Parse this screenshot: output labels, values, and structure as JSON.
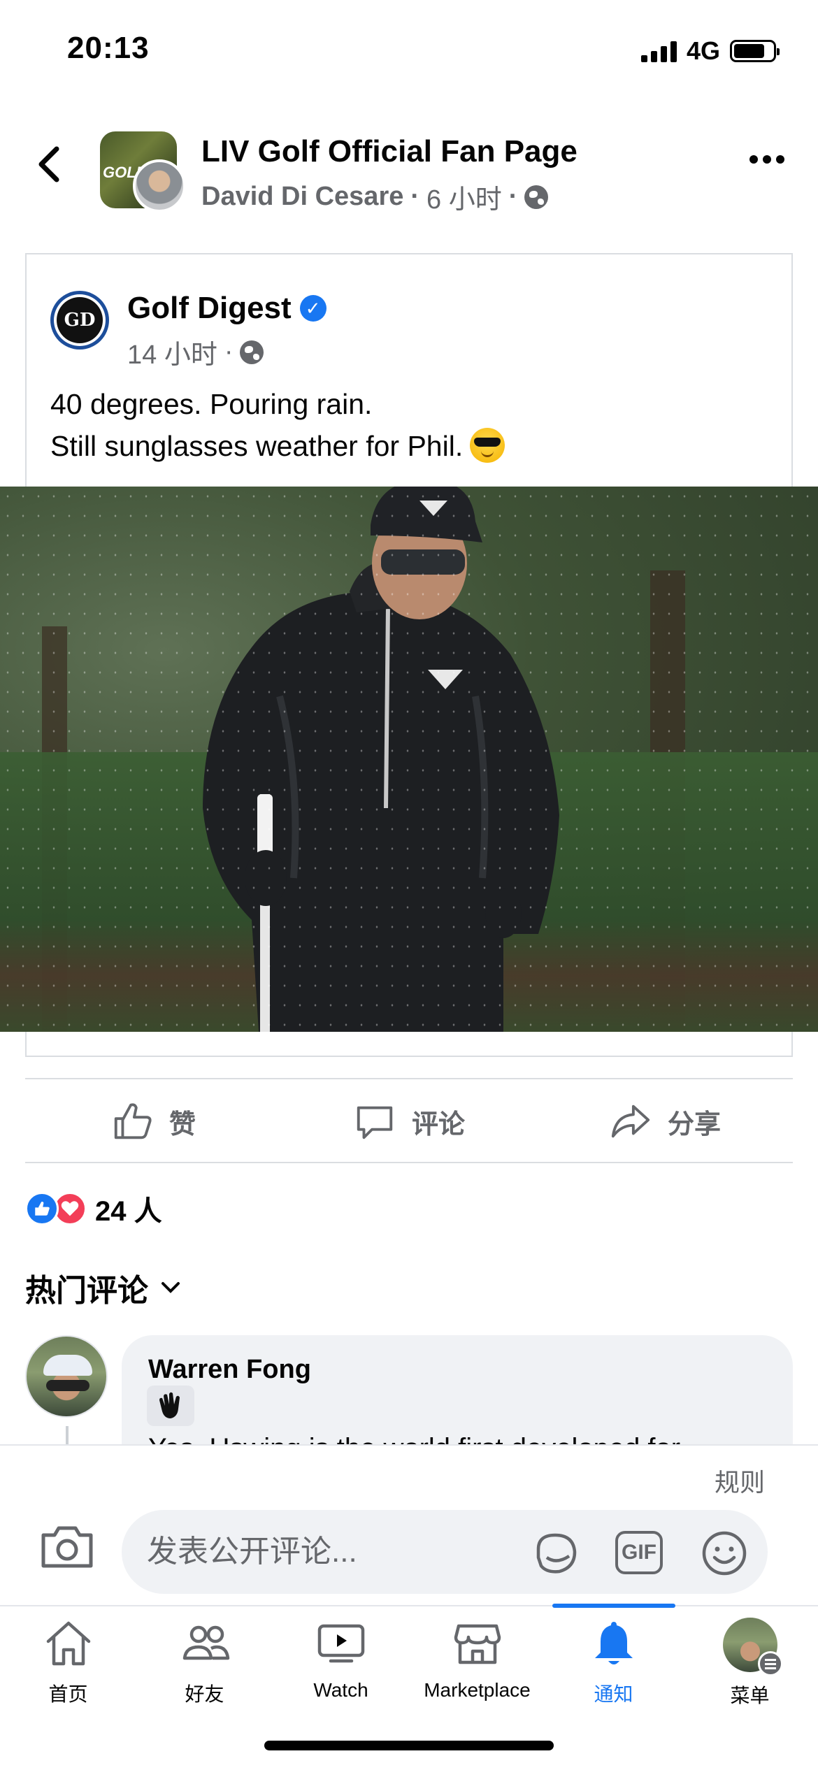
{
  "status_bar": {
    "time": "20:13",
    "network": "4G"
  },
  "header": {
    "page_name": "LIV Golf Official Fan Page",
    "author": "David Di Cesare",
    "time": "6 小时",
    "avatar_text": "GOLF"
  },
  "shared_post": {
    "author": "Golf Digest",
    "avatar_text": "GD",
    "time": "14 小时",
    "text_line1": "40 degrees. Pouring rain.",
    "text_line2": "Still sunglasses weather for Phil."
  },
  "actions": {
    "like": "赞",
    "comment": "评论",
    "share": "分享"
  },
  "reactions": {
    "count": "24 人"
  },
  "comments_section": {
    "title": "热门评论"
  },
  "comment": {
    "author": "Warren Fong",
    "text": "Yes. Uswing is the world first developed for"
  },
  "composer": {
    "rules": "规则",
    "placeholder": "发表公开评论...",
    "gif": "GIF"
  },
  "tabbar": {
    "items": [
      {
        "label": "首页"
      },
      {
        "label": "好友"
      },
      {
        "label": "Watch"
      },
      {
        "label": "Marketplace"
      },
      {
        "label": "通知"
      },
      {
        "label": "菜单"
      }
    ],
    "active_color": "#1877f2"
  }
}
